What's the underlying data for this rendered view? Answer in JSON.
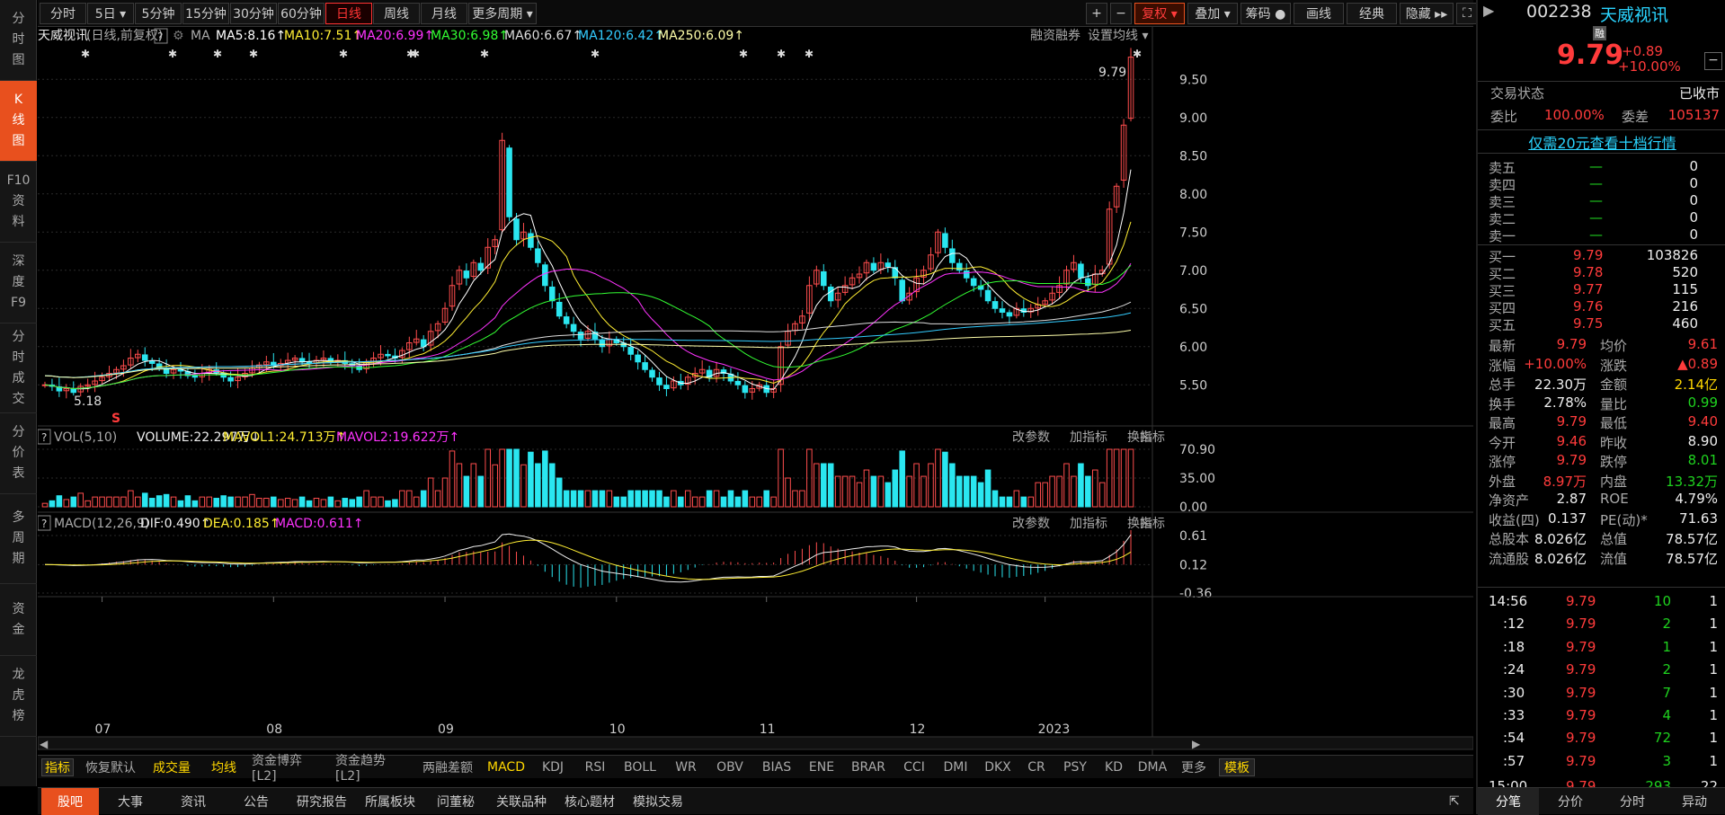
{
  "left_nav": [
    {
      "label": "分\n时\n图"
    },
    {
      "label": "K\n线\n图",
      "active": true
    },
    {
      "label": "F10\n资\n料"
    },
    {
      "label": "深\n度\nF9"
    },
    {
      "label": "分\n时\n成\n交"
    },
    {
      "label": "分\n价\n表"
    },
    {
      "label": "多\n周\n期"
    },
    {
      "label": "资\n金"
    },
    {
      "label": "龙\n虎\n榜"
    }
  ],
  "periods": [
    {
      "label": "分时"
    },
    {
      "label": "5日 ▾"
    },
    {
      "label": "5分钟"
    },
    {
      "label": "15分钟"
    },
    {
      "label": "30分钟"
    },
    {
      "label": "60分钟"
    },
    {
      "label": "日线",
      "active": true
    },
    {
      "label": "周线"
    },
    {
      "label": "月线"
    },
    {
      "label": "更多周期 ▾"
    }
  ],
  "toolbar_right": [
    {
      "label": "+"
    },
    {
      "label": "−"
    },
    {
      "label": "复权 ▾",
      "red": true
    },
    {
      "label": "叠加 ▾"
    },
    {
      "label": "筹码 ●"
    },
    {
      "label": "画线"
    },
    {
      "label": "经典"
    },
    {
      "label": "隐藏 ▸▸"
    },
    {
      "label": "⛶"
    }
  ],
  "stock": {
    "code": "002238",
    "name": "天威视讯",
    "badge": "融",
    "price": "9.79",
    "change": "+0.89",
    "pct": "+10.00%"
  },
  "ma_legend": {
    "title": "天威视讯",
    "sub": "(日线,前复权)",
    "help": "?",
    "ma": "MA",
    "items": [
      {
        "text": "MA5:8.16↑",
        "color": "#ffffff"
      },
      {
        "text": "MA10:7.51↑",
        "color": "#ffee33"
      },
      {
        "text": "MA20:6.99↑",
        "color": "#ff33ff"
      },
      {
        "text": "MA30:6.98↑",
        "color": "#33ff33"
      },
      {
        "text": "MA60:6.67↑",
        "color": "#dddddd"
      },
      {
        "text": "MA120:6.42↑",
        "color": "#33ccff"
      },
      {
        "text": "MA250:6.09↑",
        "color": "#ffffaa"
      }
    ],
    "right1": "融资融券",
    "right2": "设置均线 ▾"
  },
  "price_axis": [
    "9.50",
    "9.00",
    "8.50",
    "8.00",
    "7.50",
    "7.00",
    "6.50",
    "6.00",
    "5.50"
  ],
  "price_labels": {
    "high": "9.79",
    "low": "5.18",
    "s_mark": "S"
  },
  "vol_legend": {
    "title": "VOL(5,10)",
    "vol": "VOLUME:22.297万↓",
    "m1": "MAVOL1:24.713万↑",
    "m2": "MAVOL2:19.622万↑",
    "btns": [
      "改参数",
      "加指标",
      "换指标"
    ]
  },
  "vol_axis": [
    "70.90",
    "35.00",
    "0.00"
  ],
  "macd_legend": {
    "title": "MACD(12,26,9)",
    "dif": "DIF:0.490↑",
    "dea": "DEA:0.185↑",
    "macd": "MACD:0.611↑",
    "btns": [
      "改参数",
      "加指标",
      "换指标"
    ]
  },
  "macd_axis": [
    "0.61",
    "0.12",
    "-0.36"
  ],
  "months": [
    "07",
    "08",
    "09",
    "10",
    "11",
    "12",
    "2023"
  ],
  "indicators": [
    {
      "label": "指标",
      "active": true
    },
    {
      "label": "恢复默认"
    },
    {
      "label": "成交量",
      "y": true
    },
    {
      "label": "均线",
      "y": true
    },
    {
      "label": "资金博弈[L2]"
    },
    {
      "label": "资金趋势[L2]"
    },
    {
      "label": "两融差额"
    },
    {
      "label": "MACD",
      "y": true
    },
    {
      "label": "KDJ"
    },
    {
      "label": "RSI"
    },
    {
      "label": "BOLL"
    },
    {
      "label": "WR"
    },
    {
      "label": "OBV"
    },
    {
      "label": "BIAS"
    },
    {
      "label": "ENE"
    },
    {
      "label": "BRAR"
    },
    {
      "label": "CCI"
    },
    {
      "label": "DMI"
    },
    {
      "label": "DKX"
    },
    {
      "label": "CR"
    },
    {
      "label": "PSY"
    },
    {
      "label": "KD"
    },
    {
      "label": "DMA"
    },
    {
      "label": "更多"
    },
    {
      "label": "模板",
      "active": true
    }
  ],
  "bottom_tabs": [
    {
      "label": "股吧",
      "active": true
    },
    {
      "label": "大事"
    },
    {
      "label": "资讯"
    },
    {
      "label": "公告"
    },
    {
      "label": "研究报告"
    },
    {
      "label": "所属板块"
    },
    {
      "label": "问董秘"
    },
    {
      "label": "关联品种"
    },
    {
      "label": "核心题材"
    },
    {
      "label": "模拟交易"
    }
  ],
  "trade_status": {
    "label": "交易状态",
    "value": "已收市"
  },
  "weibi": {
    "l1": "委比",
    "v1": "100.00%",
    "l2": "委差",
    "v2": "105137"
  },
  "promo": "仅需20元查看十档行情",
  "sells": [
    {
      "label": "卖五",
      "price": "—",
      "vol": "0"
    },
    {
      "label": "卖四",
      "price": "—",
      "vol": "0"
    },
    {
      "label": "卖三",
      "price": "—",
      "vol": "0"
    },
    {
      "label": "卖二",
      "price": "—",
      "vol": "0"
    },
    {
      "label": "卖一",
      "price": "—",
      "vol": "0"
    }
  ],
  "buys": [
    {
      "label": "买一",
      "price": "9.79",
      "vol": "103826"
    },
    {
      "label": "买二",
      "price": "9.78",
      "vol": "520"
    },
    {
      "label": "买三",
      "price": "9.77",
      "vol": "115"
    },
    {
      "label": "买四",
      "price": "9.76",
      "vol": "216"
    },
    {
      "label": "买五",
      "price": "9.75",
      "vol": "460"
    }
  ],
  "stats": [
    {
      "l1": "最新",
      "v1": "9.79",
      "c1": "red",
      "l2": "均价",
      "v2": "9.61",
      "c2": "red"
    },
    {
      "l1": "涨幅",
      "v1": "+10.00%",
      "c1": "red",
      "l2": "涨跌",
      "v2": "▲0.89",
      "c2": "red"
    },
    {
      "l1": "总手",
      "v1": "22.30万",
      "c1": "white",
      "l2": "金额",
      "v2": "2.14亿",
      "c2": "yellow"
    },
    {
      "l1": "换手",
      "v1": "2.78%",
      "c1": "white",
      "l2": "量比",
      "v2": "0.99",
      "c2": "green"
    },
    {
      "l1": "最高",
      "v1": "9.79",
      "c1": "red",
      "l2": "最低",
      "v2": "9.40",
      "c2": "red"
    },
    {
      "l1": "今开",
      "v1": "9.46",
      "c1": "red",
      "l2": "昨收",
      "v2": "8.90",
      "c2": "white"
    },
    {
      "l1": "涨停",
      "v1": "9.79",
      "c1": "red",
      "l2": "跌停",
      "v2": "8.01",
      "c2": "green"
    },
    {
      "l1": "外盘",
      "v1": "8.97万",
      "c1": "red",
      "l2": "内盘",
      "v2": "13.32万",
      "c2": "green"
    },
    {
      "l1": "净资产",
      "v1": "2.87",
      "c1": "white",
      "l2": "ROE",
      "v2": "4.79%",
      "c2": "white"
    },
    {
      "l1": "收益(四)",
      "v1": "0.137",
      "c1": "white",
      "l2": "PE(动)*",
      "v2": "71.63",
      "c2": "white"
    },
    {
      "l1": "总股本",
      "v1": "8.026亿",
      "c1": "white",
      "l2": "总值",
      "v2": "78.57亿",
      "c2": "white"
    },
    {
      "l1": "流通股",
      "v1": "8.026亿",
      "c1": "white",
      "l2": "流值",
      "v2": "78.57亿",
      "c2": "white"
    }
  ],
  "ticks": [
    {
      "t": "14:56",
      "p": "9.79",
      "v": "10",
      "n": "1"
    },
    {
      "t": ":12",
      "p": "9.79",
      "v": "2",
      "n": "1"
    },
    {
      "t": ":18",
      "p": "9.79",
      "v": "1",
      "n": "1"
    },
    {
      "t": ":24",
      "p": "9.79",
      "v": "2",
      "n": "1"
    },
    {
      "t": ":30",
      "p": "9.79",
      "v": "7",
      "n": "1"
    },
    {
      "t": ":33",
      "p": "9.79",
      "v": "4",
      "n": "1"
    },
    {
      "t": ":54",
      "p": "9.79",
      "v": "72",
      "n": "1"
    },
    {
      "t": ":57",
      "p": "9.79",
      "v": "3",
      "n": "1"
    },
    {
      "t": "15:00",
      "p": "9.79",
      "v": "293",
      "n": "22"
    }
  ],
  "right_tabs": [
    {
      "label": "分笔",
      "active": true
    },
    {
      "label": "分价"
    },
    {
      "label": "分时"
    },
    {
      "label": "异动"
    }
  ],
  "chart_data": {
    "type": "candlestick",
    "close_series": [
      5.5,
      5.48,
      5.42,
      5.45,
      5.4,
      5.48,
      5.5,
      5.55,
      5.6,
      5.65,
      5.7,
      5.75,
      5.85,
      5.9,
      5.82,
      5.78,
      5.72,
      5.65,
      5.7,
      5.68,
      5.62,
      5.6,
      5.65,
      5.7,
      5.66,
      5.6,
      5.55,
      5.6,
      5.65,
      5.72,
      5.76,
      5.8,
      5.75,
      5.78,
      5.82,
      5.85,
      5.8,
      5.78,
      5.82,
      5.85,
      5.8,
      5.82,
      5.78,
      5.75,
      5.7,
      5.8,
      5.85,
      5.9,
      5.88,
      5.85,
      5.95,
      6.05,
      6.1,
      6.0,
      6.2,
      6.3,
      6.5,
      6.8,
      7.0,
      6.9,
      7.1,
      7.0,
      7.3,
      7.4,
      8.7,
      7.7,
      7.4,
      7.5,
      7.3,
      7.1,
      6.8,
      6.6,
      6.4,
      6.3,
      6.2,
      6.1,
      6.2,
      6.1,
      6.0,
      6.1,
      6.05,
      6.0,
      5.9,
      5.8,
      5.7,
      5.6,
      5.5,
      5.45,
      5.55,
      5.5,
      5.6,
      5.65,
      5.7,
      5.6,
      5.7,
      5.65,
      5.55,
      5.5,
      5.4,
      5.45,
      5.5,
      5.4,
      5.45,
      6.0,
      6.2,
      6.3,
      6.4,
      6.8,
      7.0,
      6.8,
      6.6,
      6.7,
      6.8,
      6.9,
      6.95,
      7.1,
      7.0,
      7.1,
      7.05,
      6.9,
      6.6,
      6.7,
      6.9,
      7.0,
      7.2,
      7.5,
      7.3,
      7.1,
      7.0,
      6.9,
      6.8,
      6.75,
      6.6,
      6.5,
      6.45,
      6.4,
      6.5,
      6.45,
      6.5,
      6.55,
      6.6,
      6.7,
      6.8,
      7.0,
      7.1,
      6.9,
      6.8,
      6.95,
      7.0,
      7.8,
      8.1,
      8.9,
      9.79
    ],
    "ma_values": {
      "MA5": 8.16,
      "MA10": 7.51,
      "MA20": 6.99,
      "MA30": 6.98,
      "MA60": 6.67,
      "MA120": 6.42,
      "MA250": 6.09
    },
    "ylim": [
      5.15,
      9.95
    ],
    "volume_ylim": [
      0,
      70.9
    ],
    "macd_ylim": [
      -0.36,
      0.61
    ],
    "xlabels": [
      "07",
      "08",
      "09",
      "10",
      "11",
      "12",
      "2023"
    ]
  }
}
